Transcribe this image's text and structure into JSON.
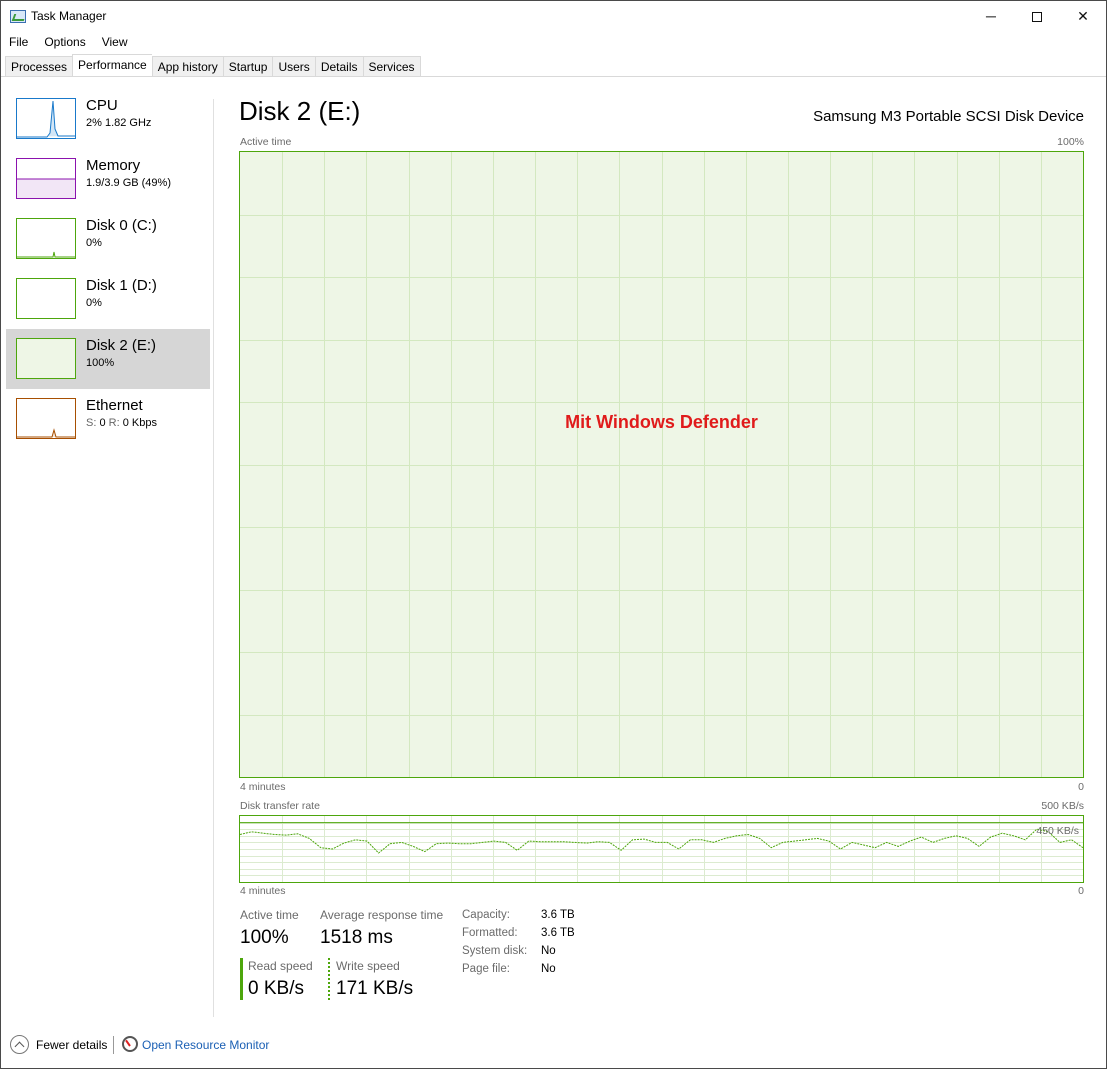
{
  "window": {
    "title": "Task Manager",
    "controls": {
      "minimize": "─",
      "close": "✕"
    }
  },
  "menu": [
    "File",
    "Options",
    "View"
  ],
  "tabs": [
    "Processes",
    "Performance",
    "App history",
    "Startup",
    "Users",
    "Details",
    "Services"
  ],
  "active_tab": "Performance",
  "sidebar": {
    "items": [
      {
        "name": "CPU",
        "sub": "2%  1.82 GHz",
        "color": "#1979ca"
      },
      {
        "name": "Memory",
        "sub": "1.9/3.9 GB (49%)",
        "color": "#8b12ae"
      },
      {
        "name": "Disk 0 (C:)",
        "sub": "0%",
        "color": "#4da60c"
      },
      {
        "name": "Disk 1 (D:)",
        "sub": "0%",
        "color": "#4da60c"
      },
      {
        "name": "Disk 2 (E:)",
        "sub": "100%",
        "color": "#4da60c",
        "selected": true
      },
      {
        "name": "Ethernet",
        "sub_s_label": "S:",
        "sub_s_value": "0",
        "sub_r_label": "R:",
        "sub_r_value": "0 Kbps",
        "color": "#a74f01"
      }
    ]
  },
  "main": {
    "title": "Disk 2 (E:)",
    "device": "Samsung M3 Portable SCSI Disk Device",
    "active_time_label": "Active time",
    "active_time_max": "100%",
    "time_left_label": "4 minutes",
    "time_right_label": "0",
    "overlay_text": "Mit Windows Defender",
    "transfer_label": "Disk transfer rate",
    "transfer_max": "500 KB/s",
    "transfer_line_label": "450 KB/s",
    "transfer_time_left": "4 minutes",
    "transfer_time_right": "0"
  },
  "chart_data": [
    {
      "type": "area",
      "title": "Active time",
      "ylim": [
        0,
        100
      ],
      "y_unit": "%",
      "x_label_left": "4 minutes",
      "x_label_right": "0",
      "series": [
        {
          "values": [
            100,
            100,
            100,
            100,
            100,
            100,
            100,
            100,
            100,
            100,
            100,
            100,
            100,
            100,
            100,
            100,
            100,
            100,
            100,
            100
          ]
        }
      ],
      "grid": true
    },
    {
      "type": "line",
      "title": "Disk transfer rate",
      "ylim": [
        0,
        500
      ],
      "y_unit": "KB/s",
      "reference_line": 450,
      "x_label_left": "4 minutes",
      "x_label_right": "0",
      "series": [
        {
          "values": [
            360,
            380,
            370,
            360,
            355,
            365,
            330,
            260,
            250,
            295,
            320,
            310,
            220,
            290,
            300,
            270,
            230,
            290,
            295,
            290,
            290,
            300,
            310,
            300,
            240,
            310,
            305,
            305,
            305,
            300,
            295,
            305,
            300,
            240,
            320,
            325,
            300,
            300,
            250,
            320,
            320,
            300,
            330,
            350,
            360,
            330,
            260,
            300,
            310,
            320,
            330,
            310,
            250,
            300,
            280,
            260,
            300,
            270,
            310,
            340,
            300,
            330,
            350,
            330,
            270,
            340,
            370,
            350,
            320,
            400,
            380,
            300,
            320,
            260
          ]
        }
      ],
      "grid": true
    }
  ],
  "stats": {
    "active_time_label": "Active time",
    "active_time_value": "100%",
    "avg_resp_label": "Average response time",
    "avg_resp_value": "1518 ms",
    "read_label": "Read speed",
    "read_value": "0 KB/s",
    "write_label": "Write speed",
    "write_value": "171 KB/s",
    "capacity_key": "Capacity:",
    "capacity_value": "3.6 TB",
    "formatted_key": "Formatted:",
    "formatted_value": "3.6 TB",
    "system_disk_key": "System disk:",
    "system_disk_value": "No",
    "page_file_key": "Page file:",
    "page_file_value": "No"
  },
  "footer": {
    "fewer_details": "Fewer details",
    "open_resource_monitor": "Open Resource Monitor"
  }
}
